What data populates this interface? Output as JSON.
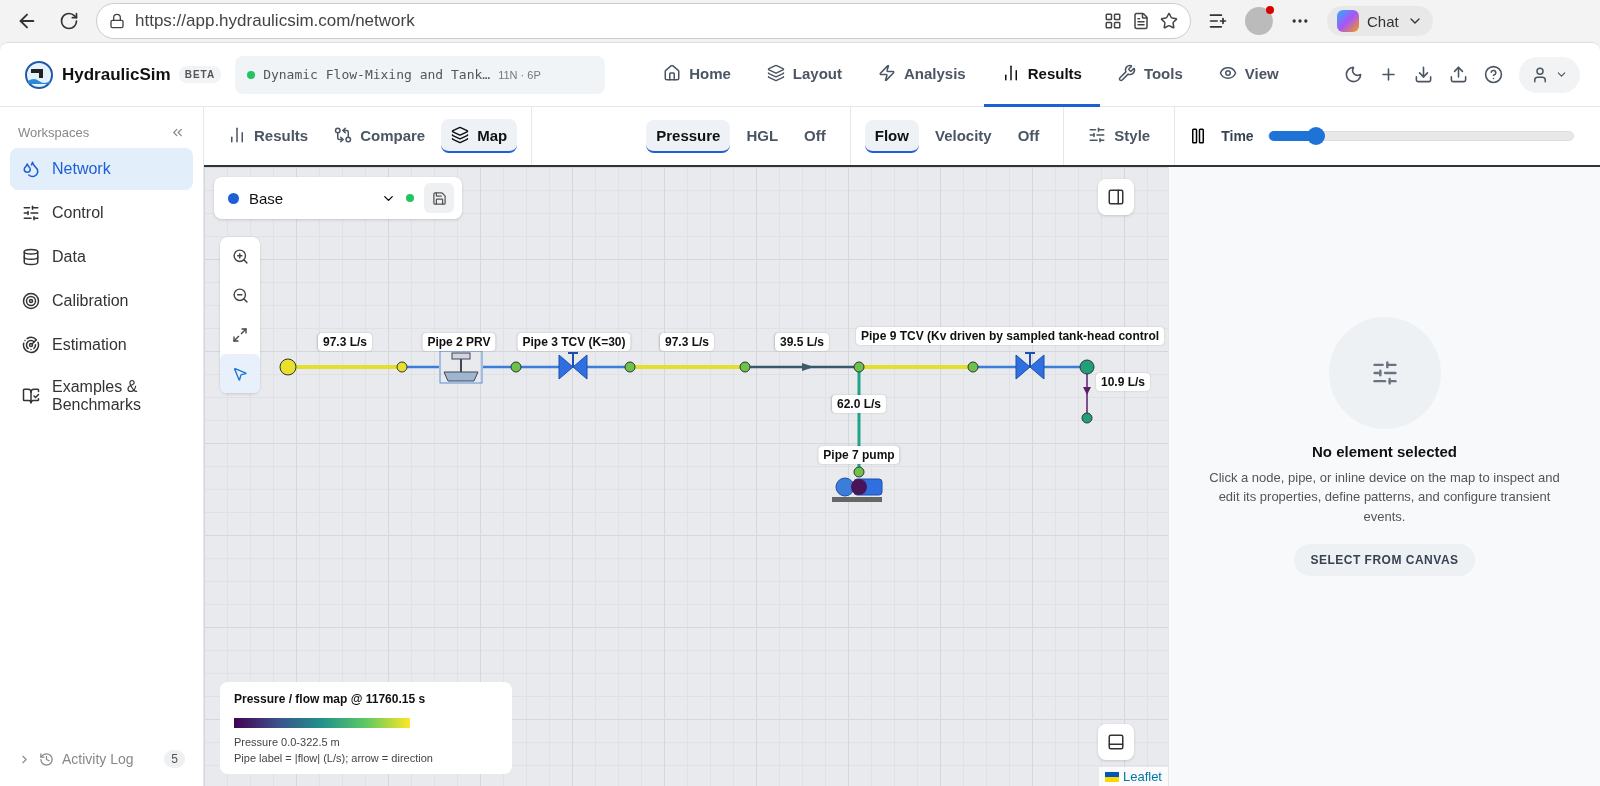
{
  "browser": {
    "url": "https://app.hydraulicsim.com/network",
    "chat_label": "Chat"
  },
  "app": {
    "name": "HydraulicSim",
    "badge": "BETA",
    "project_title": "Dynamic Flow-Mixing and Tank…",
    "project_counts": "11N · 6P"
  },
  "nav": [
    {
      "label": "Home",
      "selected": false
    },
    {
      "label": "Layout",
      "selected": false
    },
    {
      "label": "Analysis",
      "selected": false
    },
    {
      "label": "Results",
      "selected": true
    },
    {
      "label": "Tools",
      "selected": false
    },
    {
      "label": "View",
      "selected": false
    }
  ],
  "sidebar": {
    "title": "Workspaces",
    "items": [
      {
        "label": "Network",
        "selected": true
      },
      {
        "label": "Control",
        "selected": false
      },
      {
        "label": "Data",
        "selected": false
      },
      {
        "label": "Calibration",
        "selected": false
      },
      {
        "label": "Estimation",
        "selected": false
      },
      {
        "label": "Examples & Benchmarks",
        "selected": false
      }
    ],
    "footer_label": "Activity Log",
    "footer_count": "5"
  },
  "toolbar": {
    "views": [
      {
        "label": "Results",
        "selected": false
      },
      {
        "label": "Compare",
        "selected": false
      },
      {
        "label": "Map",
        "selected": true
      }
    ],
    "pressure_modes": [
      {
        "label": "Pressure",
        "selected": true
      },
      {
        "label": "HGL",
        "selected": false
      },
      {
        "label": "Off",
        "selected": false
      }
    ],
    "flow_modes": [
      {
        "label": "Flow",
        "selected": true
      },
      {
        "label": "Velocity",
        "selected": false
      },
      {
        "label": "Off",
        "selected": false
      }
    ],
    "style_label": "Style",
    "time_label": "Time",
    "time": {
      "level": 0.155
    }
  },
  "map": {
    "scenario": "Base",
    "labels": [
      "97.3 L/s",
      "Pipe 2 PRV",
      "Pipe 3 TCV (K=30)",
      "97.3 L/s",
      "39.5 L/s",
      "Pipe 9 TCV (Kv driven by sampled tank-head control",
      "10.9 L/s",
      "62.0 L/s",
      "Pipe 7 pump"
    ],
    "legend": {
      "title": "Pressure / flow map @ 11760.15 s",
      "range": "Pressure 0.0-322.5 m",
      "note": "Pipe label = |flow| (L/s); arrow = direction"
    },
    "attribution": "Leaflet"
  },
  "inspector": {
    "title": "No element selected",
    "description": "Click a node, pipe, or inline device on the map to inspect and edit its properties, define patterns, and configure transient events.",
    "button": "SELECT FROM CANVAS"
  }
}
